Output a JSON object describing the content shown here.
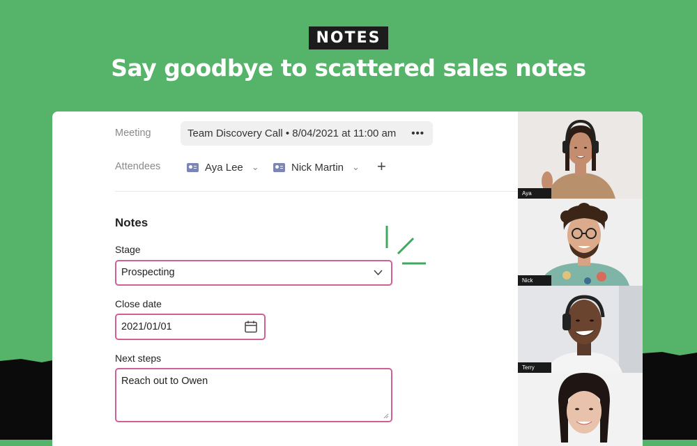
{
  "banner": {
    "tag": "NOTES",
    "headline": "Say goodbye to scattered sales notes"
  },
  "meeting": {
    "label": "Meeting",
    "value": "Team Discovery Call • 8/04/2021 at 11:00 am",
    "more_icon": "more-horizontal-icon"
  },
  "attendees": {
    "label": "Attendees",
    "people": [
      {
        "name": "Aya Lee"
      },
      {
        "name": "Nick Martin"
      }
    ],
    "add_icon": "plus-icon"
  },
  "notes": {
    "title": "Notes",
    "stage": {
      "label": "Stage",
      "value": "Prospecting"
    },
    "close_date": {
      "label": "Close date",
      "value": "2021/01/01"
    },
    "next_steps": {
      "label": "Next steps",
      "value": "Reach out to Owen"
    }
  },
  "video_tiles": [
    {
      "name": "Aya"
    },
    {
      "name": "Nick"
    },
    {
      "name": "Terry"
    },
    {
      "name": ""
    }
  ],
  "colors": {
    "background": "#56b36a",
    "accent_pink": "#cf5f97",
    "sparkle_green": "#3fa860",
    "dark": "#1c1c1c"
  }
}
